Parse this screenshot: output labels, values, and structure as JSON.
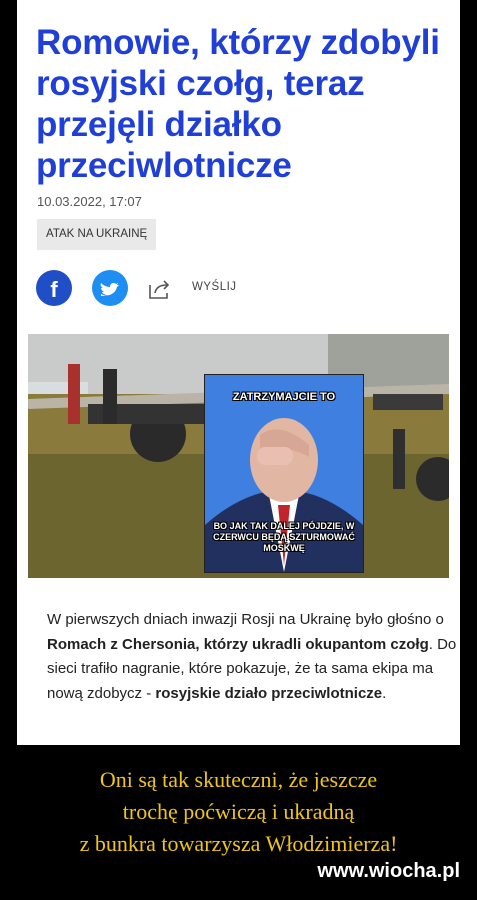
{
  "article": {
    "title": "Romowie, którzy zdobyli rosyjski czołg, teraz przejęli działko przeciwlotnicze",
    "date": "10.03.2022, 17:07",
    "tag": "ATAK NA UKRAINĘ",
    "share_label": "WYŚLIJ",
    "body": {
      "p1": "W pierwszych dniach inwazji Rosji na Ukrainę było głośno o ",
      "b1": "Romach z Chersonia, którzy ukradli okupantom czołg",
      "p2": ". Do sieci trafiło nagranie, które pokazuje, że ta sama ekipa ma nową zdobycz - ",
      "b2": "rosyjskie działo przeciwlotnicze",
      "p3": "."
    }
  },
  "meme": {
    "top": "ZATRZYMAJCIE TO",
    "bottom": "BO JAK TAK DALEJ PÓJDZIE, W CZERWCU BĘDĄ SZTURMOWAĆ MOSKWĘ"
  },
  "icons": {
    "facebook": "facebook-icon",
    "twitter": "twitter-icon",
    "share": "share-icon"
  },
  "colors": {
    "headline": "#1f3fd7",
    "facebook": "#1f4ec7",
    "twitter": "#1e8ef2",
    "caption": "#f0c419"
  },
  "caption": {
    "line1": "Oni są tak skuteczni, że jeszcze",
    "line2": "trochę poćwiczą i ukradną",
    "line3": "z bunkra towarzysza Włodzimierza!"
  },
  "watermark": "www.wiocha.pl"
}
